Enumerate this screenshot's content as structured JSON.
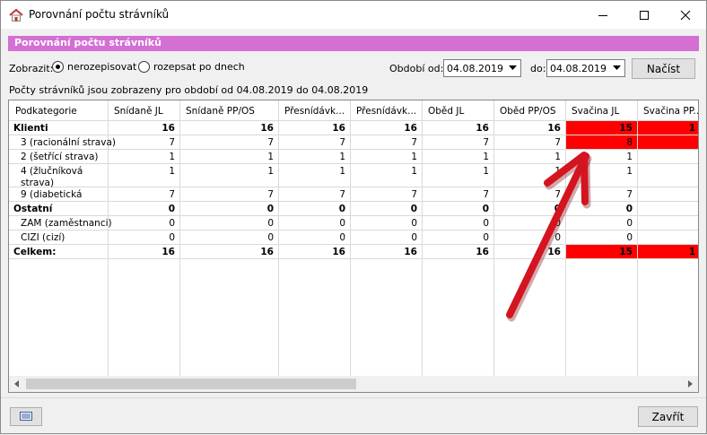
{
  "window": {
    "title": "Porovnání počtu strávníků",
    "app_icon": "house-icon",
    "minimize_icon": "minimize-icon",
    "maximize_icon": "maximize-icon",
    "close_icon": "close-icon"
  },
  "section_title": "Porovnání počtu strávníků",
  "filter": {
    "display_label": "Zobrazit:",
    "options": [
      {
        "label": "nerozepisovat",
        "checked": true
      },
      {
        "label": "rozepsat po dnech",
        "checked": false
      }
    ],
    "period_from_label": "Období od:",
    "period_from_value": "04.08.2019",
    "period_to_label": "do:",
    "period_to_value": "04.08.2019",
    "load_button": "Načíst"
  },
  "info_text": "Počty strávníků jsou zobrazeny pro období od 04.08.2019 do 04.08.2019",
  "grid": {
    "columns": [
      "Podkategorie",
      "Snídaně JL",
      "Snídaně PP/OS",
      "Přesnídávk...",
      "Přesnídávk...",
      "Oběd JL",
      "Oběd PP/OS",
      "Svačina JL",
      "Svačina PP..."
    ],
    "rows": [
      {
        "label": [
          "Klienti"
        ],
        "values": [
          "16",
          "16",
          "16",
          "16",
          "16",
          "16",
          "15",
          "1"
        ],
        "bold": true,
        "highlight": [
          6,
          7
        ]
      },
      {
        "label": [
          "3 (racionální strava)"
        ],
        "values": [
          "7",
          "7",
          "7",
          "7",
          "7",
          "7",
          "8",
          ""
        ],
        "bold": false,
        "highlight": [
          6,
          7
        ]
      },
      {
        "label": [
          "2 (šetřící strava)"
        ],
        "values": [
          "1",
          "1",
          "1",
          "1",
          "1",
          "1",
          "1",
          ""
        ],
        "bold": false,
        "highlight": []
      },
      {
        "label": [
          "4 (žlučníková",
          "strava)"
        ],
        "values": [
          "1",
          "1",
          "1",
          "1",
          "1",
          "1",
          "1",
          ""
        ],
        "bold": false,
        "highlight": []
      },
      {
        "label": [
          "9 (diabetická"
        ],
        "values": [
          "7",
          "7",
          "7",
          "7",
          "7",
          "7",
          "7",
          ""
        ],
        "bold": false,
        "highlight": []
      },
      {
        "label": [
          "Ostatní"
        ],
        "values": [
          "0",
          "0",
          "0",
          "0",
          "0",
          "0",
          "0",
          ""
        ],
        "bold": true,
        "highlight": []
      },
      {
        "label": [
          "ZAM (zaměstnanci)"
        ],
        "values": [
          "0",
          "0",
          "0",
          "0",
          "0",
          "0",
          "0",
          ""
        ],
        "bold": false,
        "highlight": []
      },
      {
        "label": [
          "CIZI (cizí)"
        ],
        "values": [
          "0",
          "0",
          "0",
          "0",
          "0",
          "0",
          "0",
          ""
        ],
        "bold": false,
        "highlight": []
      },
      {
        "label": [
          "Celkem:"
        ],
        "values": [
          "16",
          "16",
          "16",
          "16",
          "16",
          "16",
          "15",
          "1"
        ],
        "bold": true,
        "highlight": [
          6,
          7
        ]
      }
    ],
    "highlight_color": "#ff0000",
    "header_bg": "#ffffff",
    "gridline_color": "#d9d9d9"
  },
  "footer": {
    "left_button_icon": "list-icon",
    "close_button": "Zavřít"
  },
  "annotation": {
    "arrow_color": "#d4141f",
    "arrow_icon": "red-arrow-annotation"
  }
}
